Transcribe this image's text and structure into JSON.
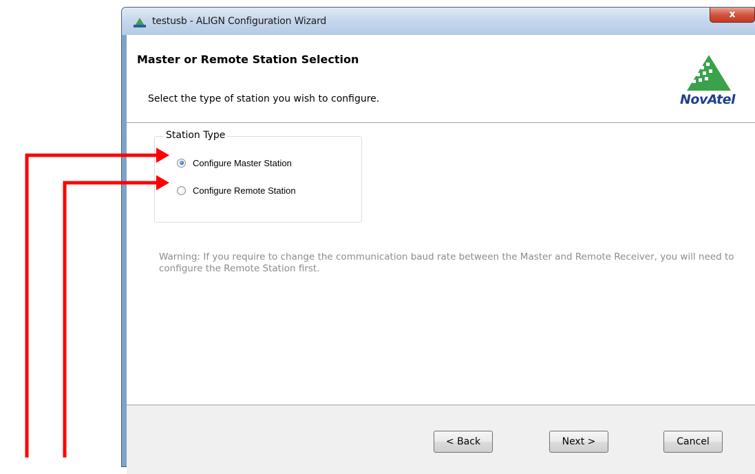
{
  "window": {
    "title": "testusb - ALIGN Configuration Wizard",
    "close_label": "x"
  },
  "header": {
    "title": "Master or Remote Station Selection",
    "subtitle": "Select the type of station you wish to configure.",
    "logo_text": "NovAtel"
  },
  "station_type": {
    "legend": "Station Type",
    "options": [
      {
        "label": "Configure Master Station",
        "checked": true
      },
      {
        "label": "Configure Remote Station",
        "checked": false
      }
    ]
  },
  "warning": "Warning: If you require to change the communication baud rate between the Master and Remote Receiver, you will need to configure the Remote Station first.",
  "buttons": {
    "back": "< Back",
    "next": "Next >",
    "cancel": "Cancel"
  },
  "colors": {
    "annotation_arrow": "#ff0000",
    "logo": "#1f3f8f",
    "logo_mark": "#3aa24a"
  },
  "icons": [
    "app-icon",
    "close-icon",
    "radio-icon",
    "logo-mark-icon"
  ]
}
